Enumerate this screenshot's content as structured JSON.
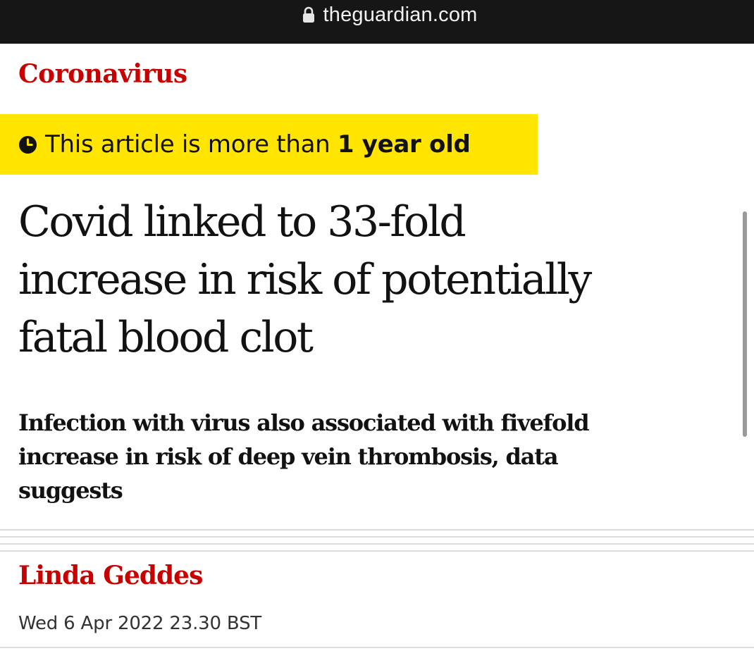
{
  "browser": {
    "url": "theguardian.com",
    "lock_icon": "lock-icon"
  },
  "article": {
    "section": "Coronavirus",
    "age_notice": {
      "prefix": "This article is more than ",
      "emphasis": "1 year old",
      "icon": "clock-icon",
      "background": "#ffe500"
    },
    "headline_lines": [
      "Covid linked to 33-fold",
      "increase in risk of potentially",
      "fatal blood clot"
    ],
    "standfirst_lines": [
      "Infection with virus also associated with fivefold",
      "increase in risk of deep vein thrombosis, data",
      "suggests"
    ],
    "byline": "Linda Geddes",
    "dateline": "Wed 6 Apr 2022 23.30 BST"
  },
  "colors": {
    "accent_red": "#c70000",
    "text": "#121212",
    "url_bar": "#161616",
    "highlight_yellow": "#ffe500"
  }
}
